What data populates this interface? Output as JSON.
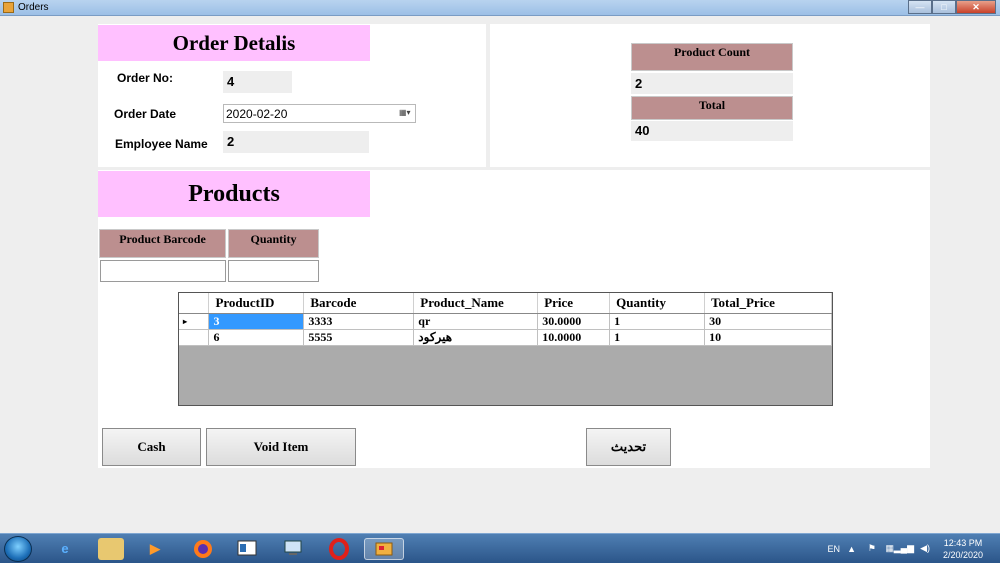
{
  "window": {
    "title": "Orders",
    "minimize": "—",
    "maximize": "□",
    "close": "✕"
  },
  "order_details": {
    "header": "Order Detalis",
    "order_no_label": "Order No:",
    "order_no_value": "4",
    "order_date_label": "Order Date",
    "order_date_value": "2020-02-20",
    "employee_name_label": "Employee Name",
    "employee_name_value": "2"
  },
  "summary": {
    "product_count_label": "Product Count",
    "product_count_value": "2",
    "total_label": "Total",
    "total_value": "40"
  },
  "products": {
    "header": "Products",
    "barcode_label": "Product Barcode",
    "quantity_label": "Quantity",
    "barcode_value": "",
    "quantity_value": ""
  },
  "grid": {
    "columns": [
      "ProductID",
      "Barcode",
      "Product_Name",
      "Price",
      "Quantity",
      "Total_Price"
    ],
    "rows": [
      [
        "3",
        "3333",
        "qr",
        "30.0000",
        "1",
        "30"
      ],
      [
        "6",
        "5555",
        "هيركود",
        "10.0000",
        "1",
        "10"
      ]
    ],
    "current_row_marker": "▸"
  },
  "buttons": {
    "cash": "Cash",
    "void_item": "Void Item",
    "refresh": "تحديث"
  },
  "taskbar": {
    "language": "EN",
    "time": "12:43 PM",
    "date": "2/20/2020",
    "icons": [
      "start-orb-icon",
      "ie-icon",
      "file-explorer-icon",
      "media-player-icon",
      "firefox-icon",
      "app-window-icon",
      "network-app-icon",
      "opera-icon",
      "orders-app-icon"
    ],
    "colors": {
      "accent": "#ffc0ff",
      "header": "#bc8f8f",
      "selected_cell": "#3399ff"
    }
  }
}
